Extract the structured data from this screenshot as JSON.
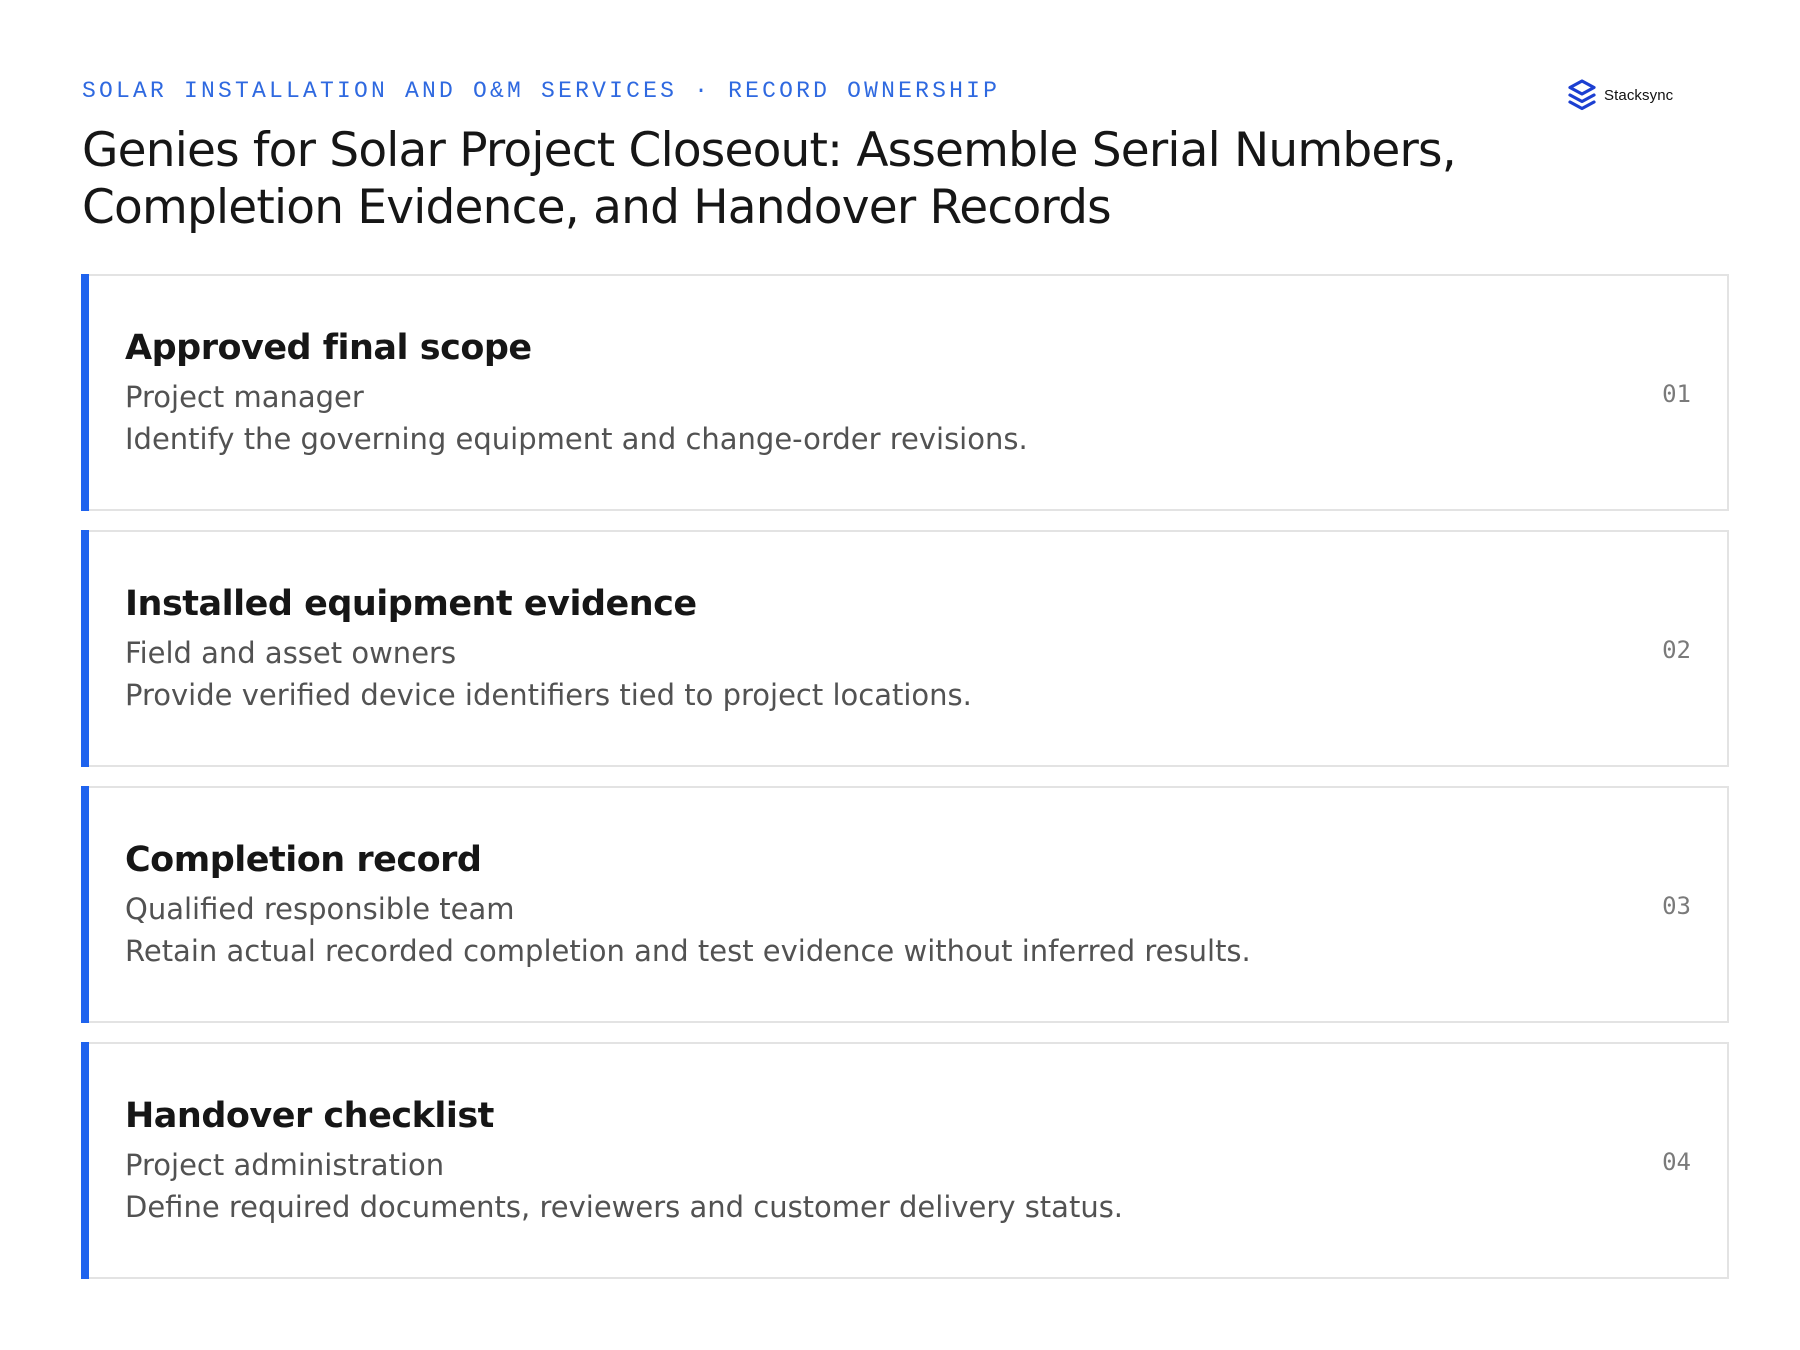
{
  "header": {
    "eyebrow": "SOLAR INSTALLATION AND O&M SERVICES · RECORD OWNERSHIP",
    "title": "Genies for Solar Project Closeout: Assemble Serial Numbers, Completion Evidence, and Handover Records"
  },
  "logo": {
    "icon": "stacksync-logo-icon",
    "text": "Stacksync"
  },
  "colors": {
    "accent": "#1f63ee",
    "eyebrow": "#2f69e0",
    "logo_mark": "#1c3fd1"
  },
  "cards": [
    {
      "title": "Approved final scope",
      "owner": "Project manager",
      "description": "Identify the governing equipment and change-order revisions.",
      "number": "01"
    },
    {
      "title": "Installed equipment evidence",
      "owner": "Field and asset owners",
      "description": "Provide verified device identifiers tied to project locations.",
      "number": "02"
    },
    {
      "title": "Completion record",
      "owner": "Qualified responsible team",
      "description": "Retain actual recorded completion and test evidence without inferred results.",
      "number": "03"
    },
    {
      "title": "Handover checklist",
      "owner": "Project administration",
      "description": "Define required documents, reviewers and customer delivery status.",
      "number": "04"
    }
  ]
}
